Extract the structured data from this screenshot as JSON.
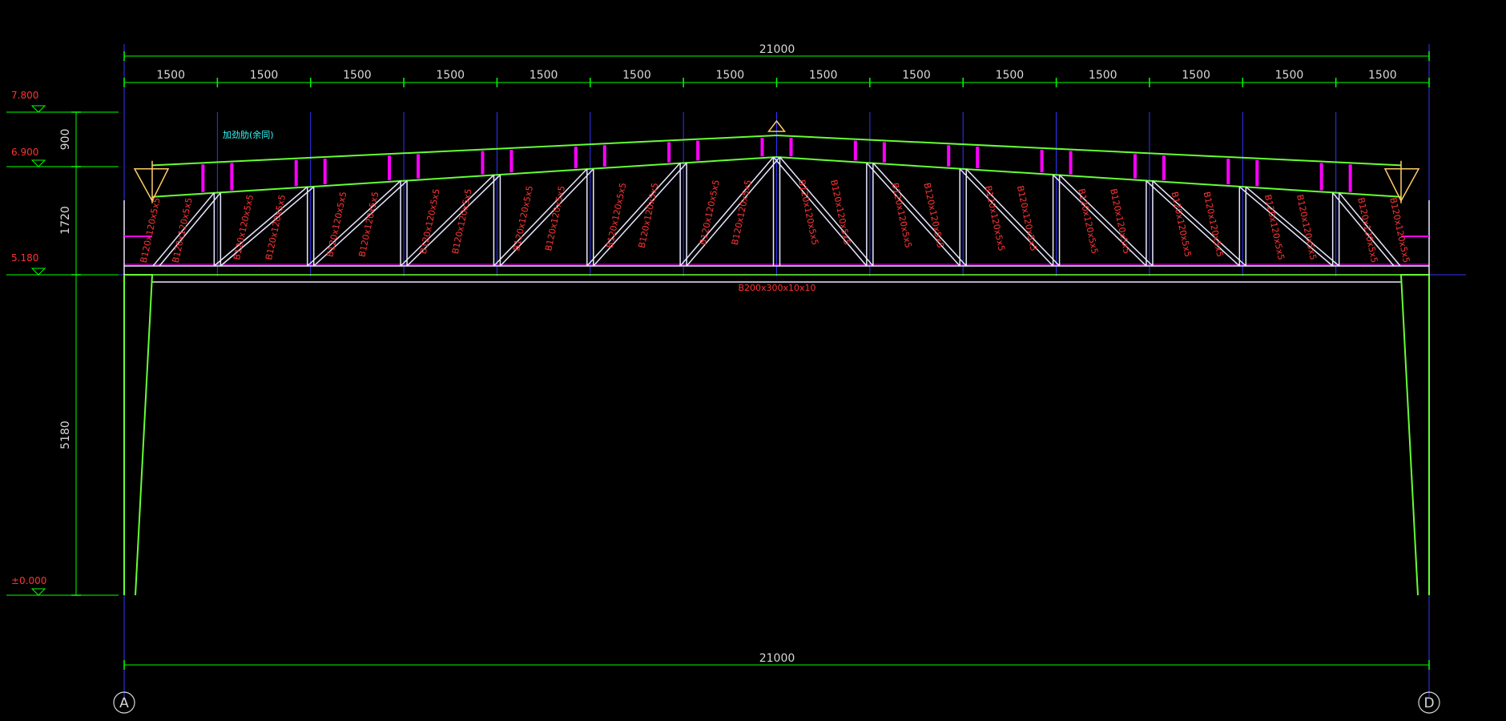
{
  "colors": {
    "background": "#000000",
    "dimension": "#00ff00",
    "frame": "#66ff33",
    "web": "#e8e8ff",
    "member_label": "#ff3333",
    "stiffener": "#ff00ff",
    "grid_line": "#3333ff",
    "elevation_text": "#ff3333",
    "note": "#33ffff",
    "support": "#ffcc66"
  },
  "dimensions": {
    "overall_top": "21000",
    "overall_bottom": "21000",
    "bays": [
      "1500",
      "1500",
      "1500",
      "1500",
      "1500",
      "1500",
      "1500",
      "1500",
      "1500",
      "1500",
      "1500",
      "1500",
      "1500",
      "1500"
    ],
    "vertical": [
      "900",
      "1720",
      "5180"
    ]
  },
  "elevations": [
    "7.800",
    "6.900",
    "5.180",
    "±0.000"
  ],
  "truss": {
    "bottom_chord_label": "B200x300x10x10",
    "member_labels": [
      "B120x120x5x5",
      "B120x120x5x5",
      "B120x120x5x5",
      "B120x120x5x5",
      "B120x120x5x5",
      "B120x120x5x5",
      "B120x120x5x5",
      "B120x120x5x5",
      "B120x120x5x5",
      "B120x120x5x5",
      "B120x120x5x5",
      "B120x120x5x5",
      "B120x120x5x5",
      "B120x120x5x5",
      "B120x120x5x5",
      "B120x120x5x5",
      "B120x120x5x5",
      "B120x120x5x5",
      "B120x120x5x5",
      "B120x120x5x5",
      "B120x120x5x5",
      "B120x120x5x5",
      "B120x120x5x5",
      "B120x120x5x5",
      "B120x120x5x5",
      "B120x120x5x5",
      "B120x120x5x5",
      "B120x120x5x5"
    ],
    "note": "加劲肋(余同)"
  },
  "axes": [
    "A",
    "D"
  ]
}
